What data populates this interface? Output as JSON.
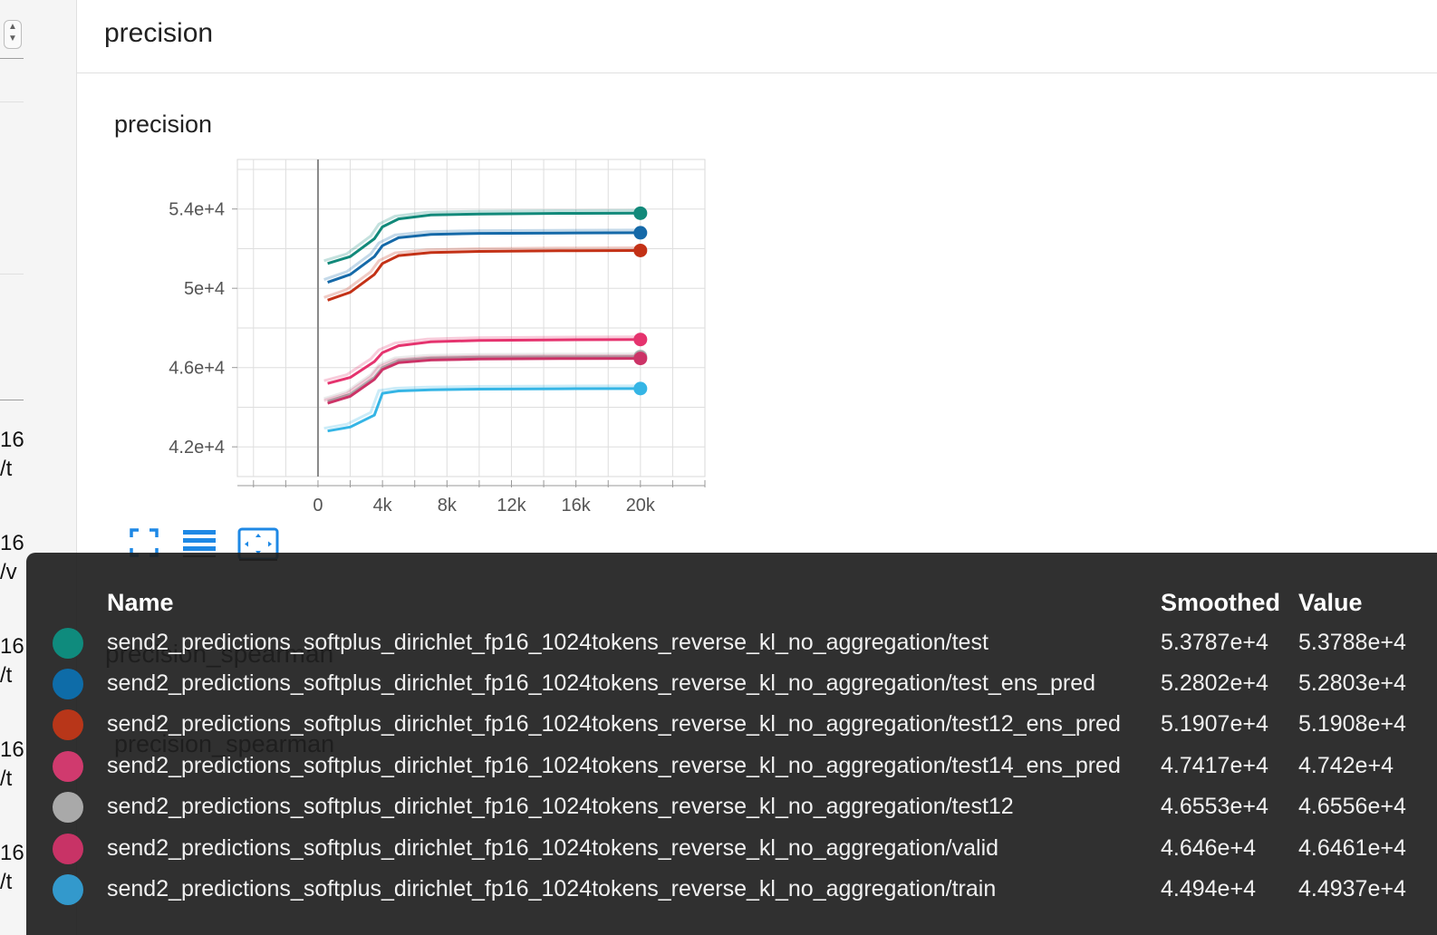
{
  "sidebar": {
    "fragments": [
      {
        "label": "16"
      },
      {
        "label": "/t"
      },
      {
        "label": "16"
      },
      {
        "label": "/v"
      },
      {
        "label": "16"
      },
      {
        "label": "/t"
      },
      {
        "label": "16"
      },
      {
        "label": "/t"
      },
      {
        "label": "16"
      },
      {
        "label": "/t"
      }
    ]
  },
  "header": {
    "title": "precision"
  },
  "card": {
    "title": "precision"
  },
  "behind": {
    "title1": "precision_spearman",
    "title2": "precision_spearman"
  },
  "chart_data": {
    "type": "line",
    "title": "precision",
    "xlabel": "",
    "ylabel": "",
    "xlim": [
      -5000,
      24000
    ],
    "ylim": [
      40500,
      56500
    ],
    "xticks": [
      0,
      4000,
      8000,
      12000,
      16000,
      20000
    ],
    "xtick_labels": [
      "0",
      "4k",
      "8k",
      "12k",
      "16k",
      "20k"
    ],
    "yticks": [
      42000,
      46000,
      50000,
      54000
    ],
    "ytick_labels": [
      "4.2e+4",
      "4.6e+4",
      "5e+4",
      "5.4e+4"
    ],
    "grid": true,
    "x": [
      600,
      2000,
      3500,
      4000,
      5000,
      7000,
      10000,
      15000,
      20000
    ],
    "series": [
      {
        "name": "send2_predictions_softplus_dirichlet_fp16_1024tokens_reverse_kl_no_aggregation/test",
        "color": "#12897a",
        "values": [
          51250,
          51600,
          52500,
          53100,
          53500,
          53700,
          53750,
          53780,
          53787
        ]
      },
      {
        "name": "send2_predictions_softplus_dirichlet_fp16_1024tokens_reverse_kl_no_aggregation/test_ens_pred",
        "color": "#1569a8",
        "values": [
          50300,
          50700,
          51600,
          52150,
          52550,
          52720,
          52770,
          52790,
          52802
        ]
      },
      {
        "name": "send2_predictions_softplus_dirichlet_fp16_1024tokens_reverse_kl_no_aggregation/test12_ens_pred",
        "color": "#c33116",
        "values": [
          49400,
          49800,
          50700,
          51250,
          51650,
          51800,
          51860,
          51890,
          51907
        ]
      },
      {
        "name": "send2_predictions_softplus_dirichlet_fp16_1024tokens_reverse_kl_no_aggregation/test14_ens_pred",
        "color": "#e5336e",
        "values": [
          45200,
          45500,
          46300,
          46750,
          47100,
          47300,
          47370,
          47400,
          47417
        ]
      },
      {
        "name": "send2_predictions_softplus_dirichlet_fp16_1024tokens_reverse_kl_no_aggregation/test12",
        "color": "#aaaaaa",
        "values": [
          44300,
          44650,
          45500,
          46000,
          46350,
          46480,
          46520,
          46540,
          46553
        ]
      },
      {
        "name": "send2_predictions_softplus_dirichlet_fp16_1024tokens_reverse_kl_no_aggregation/valid",
        "color": "#cc3367",
        "values": [
          44200,
          44550,
          45400,
          45900,
          46250,
          46380,
          46430,
          46450,
          46460
        ]
      },
      {
        "name": "send2_predictions_softplus_dirichlet_fp16_1024tokens_reverse_kl_no_aggregation/train",
        "color": "#35b5e5",
        "values": [
          42800,
          43000,
          43600,
          44700,
          44820,
          44880,
          44910,
          44930,
          44940
        ]
      }
    ]
  },
  "tooltip": {
    "headers": {
      "name": "Name",
      "smoothed": "Smoothed",
      "value": "Value"
    },
    "rows": [
      {
        "name": "send2_predictions_softplus_dirichlet_fp16_1024tokens_reverse_kl_no_aggregation/test",
        "smoothed": "5.3787e+4",
        "value": "5.3788e+4",
        "color": "#0f8b7d"
      },
      {
        "name": "send2_predictions_softplus_dirichlet_fp16_1024tokens_reverse_kl_no_aggregation/test_ens_pred",
        "smoothed": "5.2802e+4",
        "value": "5.2803e+4",
        "color": "#0e6ca8"
      },
      {
        "name": "send2_predictions_softplus_dirichlet_fp16_1024tokens_reverse_kl_no_aggregation/test12_ens_pred",
        "smoothed": "5.1907e+4",
        "value": "5.1908e+4",
        "color": "#b83619"
      },
      {
        "name": "send2_predictions_softplus_dirichlet_fp16_1024tokens_reverse_kl_no_aggregation/test14_ens_pred",
        "smoothed": "4.7417e+4",
        "value": "4.742e+4",
        "color": "#d03a6e"
      },
      {
        "name": "send2_predictions_softplus_dirichlet_fp16_1024tokens_reverse_kl_no_aggregation/test12",
        "smoothed": "4.6553e+4",
        "value": "4.6556e+4",
        "color": "#a9a9a9"
      },
      {
        "name": "send2_predictions_softplus_dirichlet_fp16_1024tokens_reverse_kl_no_aggregation/valid",
        "smoothed": "4.646e+4",
        "value": "4.6461e+4",
        "color": "#c83366"
      },
      {
        "name": "send2_predictions_softplus_dirichlet_fp16_1024tokens_reverse_kl_no_aggregation/train",
        "smoothed": "4.494e+4",
        "value": "4.4937e+4",
        "color": "#3399cc"
      }
    ]
  },
  "toolbar": {
    "icons": [
      "fullscreen-icon",
      "list-icon",
      "fit-domain-icon"
    ]
  }
}
